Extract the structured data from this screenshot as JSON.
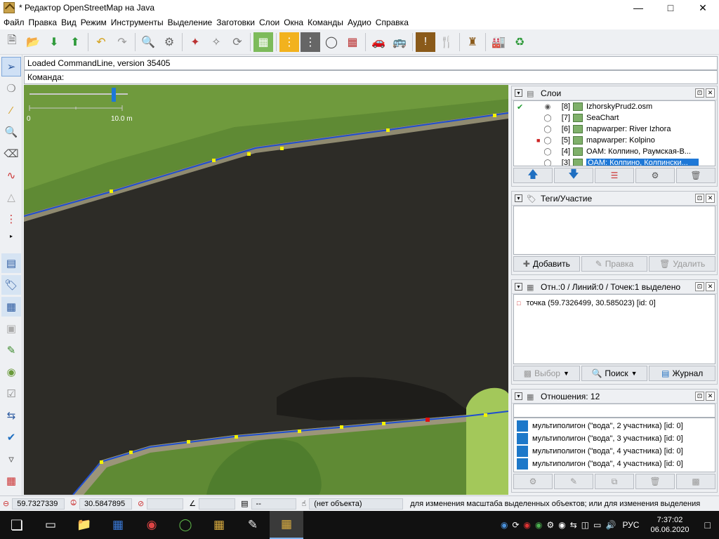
{
  "window": {
    "title": "* Редактор OpenStreetMap на Java",
    "controls": [
      "minimize-icon",
      "maximize-icon",
      "close-icon"
    ]
  },
  "menu": [
    "Файл",
    "Правка",
    "Вид",
    "Режим",
    "Инструменты",
    "Выделение",
    "Заготовки",
    "Слои",
    "Окна",
    "Команды",
    "Аудио",
    "Справка"
  ],
  "command": {
    "output": "Loaded CommandLine, version 35405",
    "prompt": "Команда:"
  },
  "map": {
    "scale_start": "0",
    "scale_end": "10.0 m",
    "colors": {
      "water": "#2d2c27",
      "way": "#2f5fd0",
      "node": "#f2f200",
      "selected_node": "#e01010"
    }
  },
  "layers_panel": {
    "title": "Слои",
    "rows": [
      {
        "index": "[8]",
        "name": "IzhorskyPrud2.osm",
        "active": true,
        "visible": true
      },
      {
        "index": "[7]",
        "name": "SeaChart"
      },
      {
        "index": "[6]",
        "name": "mapwarper: River Izhora"
      },
      {
        "index": "[5]",
        "name": "mapwarper: Kolpino",
        "flag": true
      },
      {
        "index": "[4]",
        "name": "OAM: Колпино, Раумская-В..."
      },
      {
        "index": "[3]",
        "name": "OAM: Колпино, Колпински...",
        "selected": true
      }
    ]
  },
  "tags_panel": {
    "title": "Теги/Участие",
    "add": "Добавить",
    "edit": "Правка",
    "delete": "Удалить"
  },
  "selection_panel": {
    "title": "Отн.:0 / Линий:0 / Точек:1 выделено",
    "item": "точка (59.7326499, 30.585023) [id: 0]",
    "select": "Выбор",
    "search": "Поиск",
    "history": "Журнал"
  },
  "relations_panel": {
    "title": "Отношения: 12",
    "items": [
      "мультиполигон (\"вода\", 2 участника) [id: 0]",
      "мультиполигон (\"вода\", 3 участника) [id: 0]",
      "мультиполигон (\"вода\", 4 участника) [id: 0]",
      "мультиполигон (\"вода\", 4 участника) [id: 0]"
    ]
  },
  "status": {
    "lat": "59.7327339",
    "lon": "30.5847895",
    "heading": "",
    "angle": "",
    "distance": "--",
    "object": "(нет объекта)",
    "help": "для изменения масштаба выделенных объектов; или для изменения выделения"
  },
  "taskbar": {
    "lang": "РУС",
    "time": "7:37:02",
    "date": "06.06.2020"
  }
}
